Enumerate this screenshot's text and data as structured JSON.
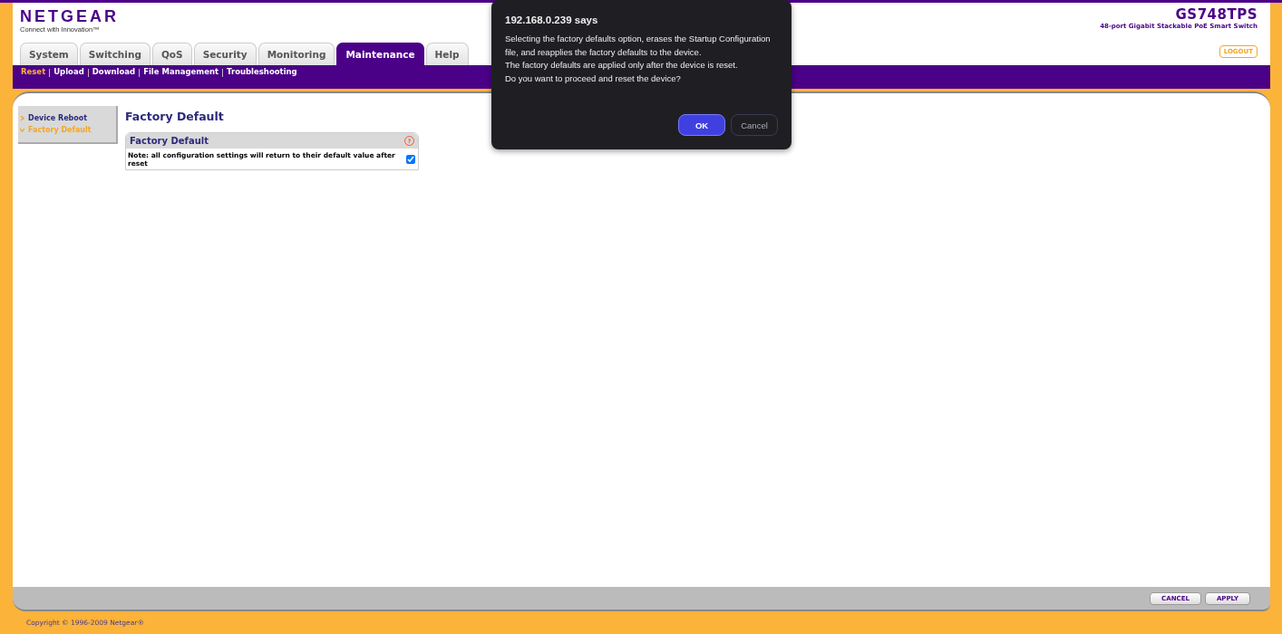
{
  "header": {
    "brand": "NETGEAR",
    "tagline": "Connect with Innovation™",
    "model": "GS748TPS",
    "model_description": "48-port Gigabit Stackable PoE Smart Switch",
    "logout": "LOGOUT"
  },
  "tabs": [
    {
      "label": "System",
      "selected": false
    },
    {
      "label": "Switching",
      "selected": false
    },
    {
      "label": "QoS",
      "selected": false
    },
    {
      "label": "Security",
      "selected": false
    },
    {
      "label": "Monitoring",
      "selected": false
    },
    {
      "label": "Maintenance",
      "selected": true
    },
    {
      "label": "Help",
      "selected": false
    }
  ],
  "subnav": [
    {
      "label": "Reset",
      "selected": true
    },
    {
      "label": "Upload",
      "selected": false
    },
    {
      "label": "Download",
      "selected": false
    },
    {
      "label": "File Management",
      "selected": false
    },
    {
      "label": "Troubleshooting",
      "selected": false
    }
  ],
  "sidebar": {
    "items": [
      {
        "label": "Device Reboot",
        "selected": false
      },
      {
        "label": "Factory Default",
        "selected": true
      }
    ]
  },
  "page_title": "Factory Default",
  "panel": {
    "title": "Factory Default",
    "help": "?",
    "note": "Note: all configuration settings will return to their default value after reset",
    "checked": true
  },
  "footer_buttons": [
    "CANCEL",
    "APPLY"
  ],
  "copyright": "Copyright © 1996-2009 Netgear®",
  "dialog": {
    "title": "192.168.0.239 says",
    "lines": [
      "Selecting the factory defaults option, erases the Startup Configuration file, and reapplies the factory defaults to the device.",
      "The factory defaults are applied only after the device is reset.",
      "Do you want to proceed and reset the device?"
    ],
    "ok": "OK",
    "cancel": "Cancel"
  }
}
